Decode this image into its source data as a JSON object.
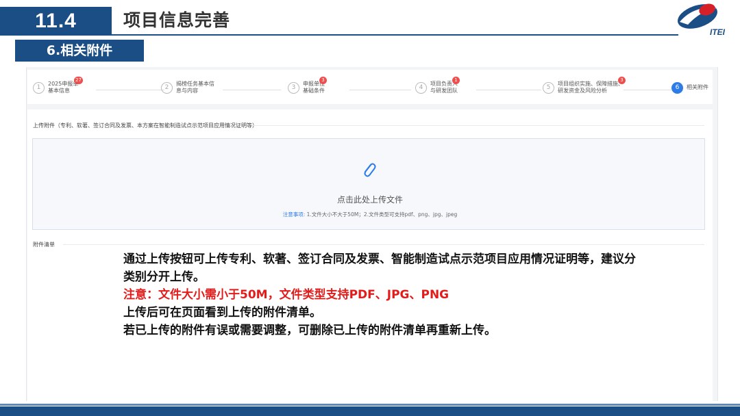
{
  "slide": {
    "number": "11.4",
    "title": "项目信息完善",
    "section": "6.相关附件",
    "logo_text": "ITEI"
  },
  "colors": {
    "brand": "#1c4e86",
    "accent": "#2f7ce6",
    "badge": "#f04d4d",
    "warning": "#e21b1b"
  },
  "steps": [
    {
      "index": "1",
      "label": "2025申报单\n基本信息",
      "badge": "27",
      "active": false
    },
    {
      "index": "2",
      "label": "揭榜任务基本信\n息与内容",
      "badge": "",
      "active": false
    },
    {
      "index": "3",
      "label": "申报单位\n基础条件",
      "badge": "3",
      "active": false
    },
    {
      "index": "4",
      "label": "项目负责人\n与研发团队",
      "badge": "1",
      "active": false
    },
    {
      "index": "5",
      "label": "项目组织实施、保障措施、\n研发资金及风险分析",
      "badge": "3",
      "active": false
    },
    {
      "index": "6",
      "label": "相关附件",
      "badge": "",
      "active": true
    }
  ],
  "upload": {
    "label": "上传附件（专利、软著、签订合同及发票、本方案在智能制造试点示范项目应用情况证明等）",
    "icon": "paperclip-icon",
    "prompt": "点击此处上传文件",
    "note_label": "注意事项:",
    "note_text": "1.文件大小不大于50M；2.文件类型可支持pdf、png、jpg、jpeg"
  },
  "attachment_list": {
    "label": "附件清单"
  },
  "annotation": {
    "line1": "通过上传按钮可上传专利、软著、签订合同及发票、智能制造试点示范项目应用情况证明等，建议分类别分开上传。",
    "line2": "注意：文件大小需小于50M，文件类型支持PDF、JPG、PNG",
    "line3": "上传后可在页面看到上传的附件清单。",
    "line4": "若已上传的附件有误或需要调整，可删除已上传的附件清单再重新上传。"
  }
}
